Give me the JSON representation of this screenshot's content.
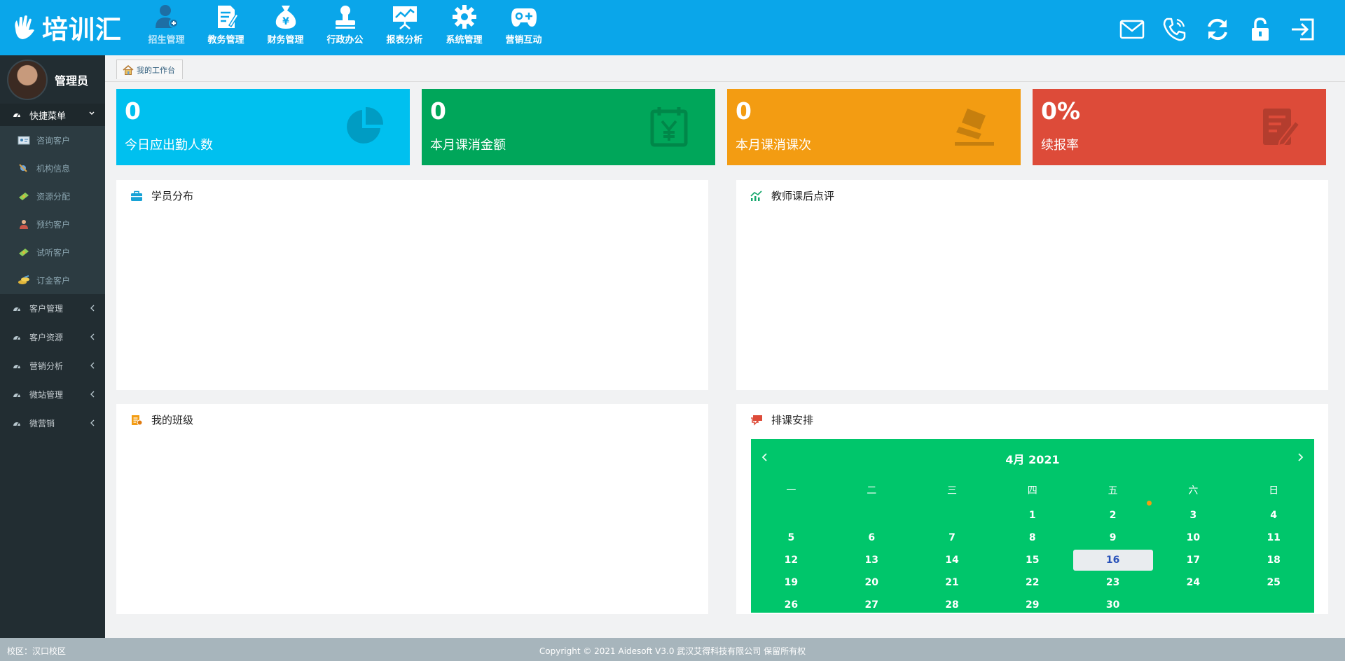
{
  "header": {
    "logo_text": "培训汇",
    "nav": [
      {
        "label": "招生管理",
        "icon": "user-add-icon",
        "active": true
      },
      {
        "label": "教务管理",
        "icon": "document-edit-icon"
      },
      {
        "label": "财务管理",
        "icon": "money-bag-icon"
      },
      {
        "label": "行政办公",
        "icon": "stamp-icon"
      },
      {
        "label": "报表分析",
        "icon": "chart-board-icon"
      },
      {
        "label": "系统管理",
        "icon": "gear-icon"
      },
      {
        "label": "营销互动",
        "icon": "gamepad-icon"
      }
    ],
    "tools": [
      "mail-icon",
      "phone-icon",
      "refresh-icon",
      "lock-icon",
      "logout-icon"
    ],
    "color": "#0aa6ea"
  },
  "sidebar": {
    "user": "管理员",
    "quick_menu": {
      "label": "快捷菜单",
      "items": [
        {
          "label": "咨询客户",
          "icon": "id-card-icon"
        },
        {
          "label": "机构信息",
          "icon": "satellite-icon"
        },
        {
          "label": "资源分配",
          "icon": "money-icon"
        },
        {
          "label": "预约客户",
          "icon": "person-icon"
        },
        {
          "label": "试听客户",
          "icon": "money-icon"
        },
        {
          "label": "订金客户",
          "icon": "coins-icon"
        }
      ]
    },
    "groups": [
      {
        "label": "客户管理"
      },
      {
        "label": "客户资源"
      },
      {
        "label": "营销分析"
      },
      {
        "label": "微站管理"
      },
      {
        "label": "微营销"
      }
    ]
  },
  "breadcrumb": {
    "tab": "我的工作台"
  },
  "stats": [
    {
      "value": "0",
      "label": "今日应出勤人数",
      "color": "#00c0ef",
      "icon": "pie-chart-icon"
    },
    {
      "value": "0",
      "label": "本月课消金额",
      "color": "#00a65a",
      "icon": "yen-calendar-icon"
    },
    {
      "value": "0",
      "label": "本月课消课次",
      "color": "#f39c12",
      "icon": "stamp-icon"
    },
    {
      "value": "0%",
      "label": "续报率",
      "color": "#dd4b39",
      "icon": "edit-note-icon"
    }
  ],
  "panels": {
    "students": "学员分布",
    "reviews": "教师课后点评",
    "classes": "我的班级",
    "schedule": "排课安排"
  },
  "calendar": {
    "title": "4月 2021",
    "weekdays": [
      "一",
      "二",
      "三",
      "四",
      "五",
      "六",
      "日"
    ],
    "weeks": [
      [
        "",
        "",
        "",
        "1",
        "2",
        "3",
        "4"
      ],
      [
        "5",
        "6",
        "7",
        "8",
        "9",
        "10",
        "11"
      ],
      [
        "12",
        "13",
        "14",
        "15",
        "16",
        "17",
        "18"
      ],
      [
        "19",
        "20",
        "21",
        "22",
        "23",
        "24",
        "25"
      ],
      [
        "26",
        "27",
        "28",
        "29",
        "30",
        "",
        ""
      ]
    ],
    "today": "16",
    "color": "#00c66b"
  },
  "footer": {
    "campus": "校区：汉口校区",
    "copyright": "Copyright © 2021 Aidesoft V3.0 武汉艾得科技有限公司 保留所有权"
  }
}
